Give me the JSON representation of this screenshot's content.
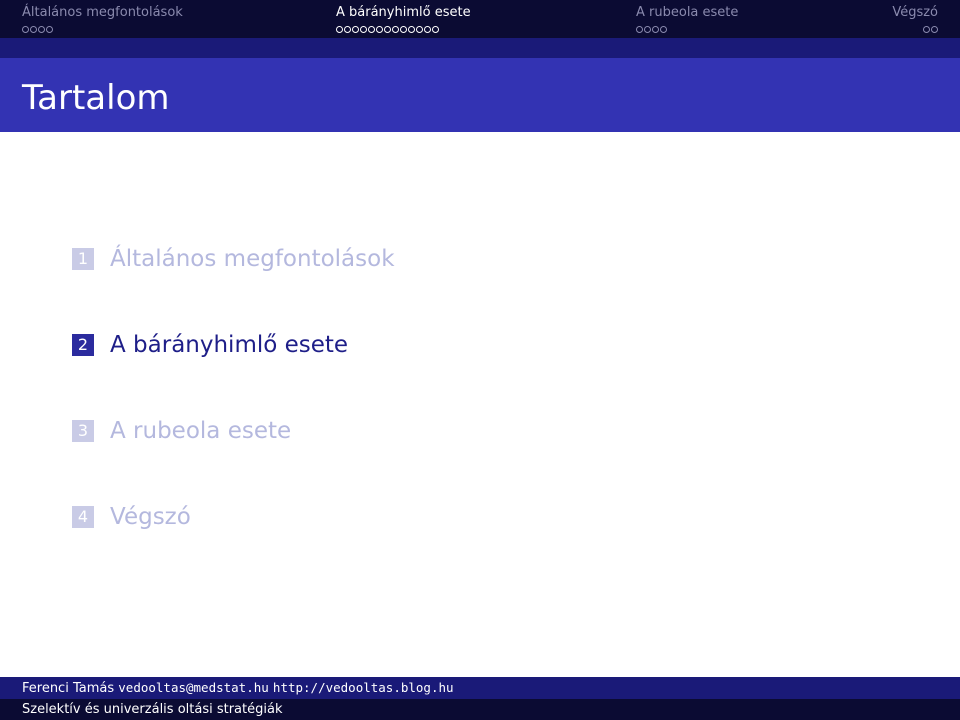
{
  "nav": {
    "sections": [
      {
        "title": "Általános megfontolások",
        "frames": 4,
        "active": false
      },
      {
        "title": "A bárányhimlő esete",
        "frames": 13,
        "active": true
      },
      {
        "title": "A rubeola esete",
        "frames": 4,
        "active": false
      },
      {
        "title": "Végszó",
        "frames": 2,
        "active": false
      }
    ]
  },
  "frame": {
    "title": "Tartalom"
  },
  "toc": [
    {
      "num": "1",
      "label": "Általános megfontolások",
      "state": "dim"
    },
    {
      "num": "2",
      "label": "A bárányhimlő esete",
      "state": "current"
    },
    {
      "num": "3",
      "label": "A rubeola esete",
      "state": "dim"
    },
    {
      "num": "4",
      "label": "Végszó",
      "state": "dim"
    }
  ],
  "footer": {
    "author": "Ferenci Tamás",
    "email": "vedooltas@medstat.hu",
    "url": "http://vedooltas.blog.hu",
    "talk_title": "Szelektív és univerzális oltási stratégiák"
  },
  "colors": {
    "nav_bg": "#0b0b33",
    "band_bg": "#1a1a78",
    "title_bg": "#3333b3",
    "toc_current": "#1e1e88",
    "toc_dim": "#b4b8de"
  }
}
